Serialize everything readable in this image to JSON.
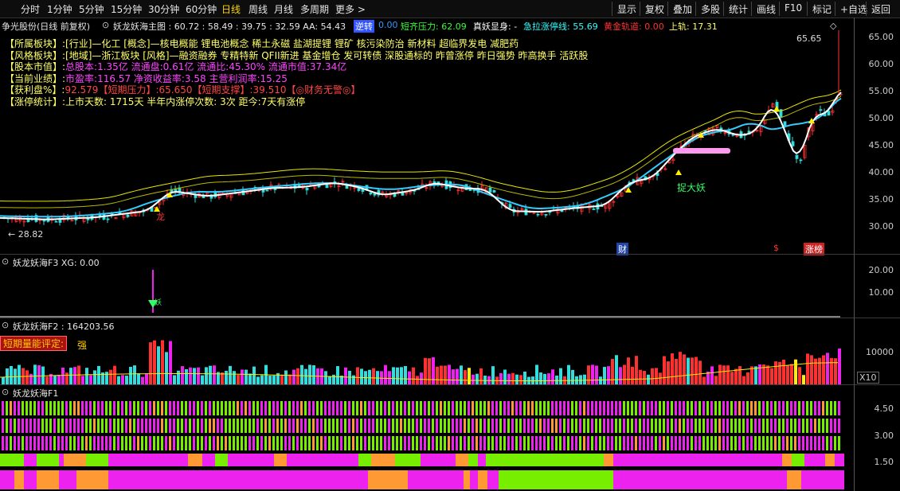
{
  "topbar": {
    "periods": [
      "分时",
      "1分钟",
      "5分钟",
      "15分钟",
      "30分钟",
      "60分钟",
      "日线",
      "周线",
      "月线",
      "多周期",
      "更多 >"
    ],
    "active": "日线",
    "right_buttons": [
      "显示",
      "复权",
      "叠加",
      "多股",
      "统计",
      "画线",
      "F10",
      "标记",
      "+自选",
      "返回"
    ]
  },
  "main": {
    "stock": "争光股份(日线 前复权)",
    "indicator": "妖龙妖海主图 : 60.72 : 58.49 : 39.75 : 32.59 AA: 54.43",
    "tag_blue": "逆转",
    "tag_blue_val": "0.00",
    "duanqi": "短齐压力: 62.09",
    "zhenyao": "真妖显身: -",
    "jila": "急拉涨停线: 55.69",
    "huangjin": "黄金轨道: 0.00",
    "shanggui": "上轨: 17.31",
    "axis": [
      "65.00",
      "60.00",
      "55.00",
      "50.00",
      "45.00",
      "40.00",
      "35.00",
      "30.00"
    ],
    "high_label": "65.65",
    "low_label": "← 28.82",
    "zhuo": "捉大妖",
    "long": "龙",
    "cai": "财",
    "dollar": "$",
    "zhangbang": "涨榜",
    "info_lines": [
      {
        "label": "【所属板块】:",
        "text": "[行业]—化工 [概念]—核电概能 锂电池概念 稀土永磁 盐湖提锂 锂矿 核污染防治 新材料 超临界发电 减肥药",
        "color": "#ffff66"
      },
      {
        "label": "【风格板块】:",
        "text": "[地域]—浙江板块 [风格]—融资融券 专精特新 QFII新进 基金增仓 发可转债 深股通标的 昨曾涨停 昨日强势 昨高换手 活跃股",
        "color": "#ffff66"
      },
      {
        "label": "【股本市值】:",
        "text": "总股本:1.35亿 流通盘:0.61亿 流通比:45.30% 流通市值:37.34亿",
        "color": "#ff44ff"
      },
      {
        "label": "【当前业绩】:",
        "text": "市盈率:116.57 净资收益率:3.58 主营利润率:15.25",
        "color": "#ff44ff"
      },
      {
        "label": "【获利盘%】:",
        "text": "92.579【短期压力】:65.650【短期支撑】:39.510【◎财务无警◎】",
        "color": "#ff4444"
      },
      {
        "label": "【涨停统计】:",
        "text": "上市天数: 1715天 半年内涨停次数: 3次  距今:7天有涨停",
        "color": "#ffff66"
      }
    ]
  },
  "f3": {
    "title": "妖龙妖海F3 XG: 0.00",
    "axis": [
      "20.00",
      "10.00"
    ],
    "mark": "妖"
  },
  "f2": {
    "title": "妖龙妖海F2 : 164203.56",
    "badge": "短期量能评定:",
    "badge_val": "强",
    "axis": [
      "10000"
    ],
    "unit": "X10"
  },
  "f1": {
    "title": "妖龙妖海F1",
    "axis": [
      "4.50",
      "3.00",
      "1.50"
    ]
  },
  "colors": {
    "up": "#ff3030",
    "down": "#33dddd",
    "white": "#ffffff",
    "cyan": "#33ccff",
    "yellow": "#e6e600",
    "magenta": "#ee22ee",
    "orange": "#ff9933",
    "green": "#77ee00"
  }
}
